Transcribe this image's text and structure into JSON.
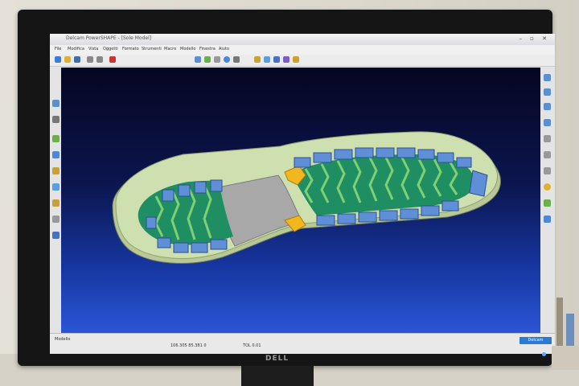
{
  "photo": {
    "subject": "monitor showing CAD shoe sole design",
    "monitor_brand": "DELL"
  },
  "window": {
    "title": "Delcam PowerSHAPE - [Sole Model]",
    "controls": "– ▫ ✕"
  },
  "menu": [
    "File",
    "Modifica",
    "Vista",
    "Oggetti",
    "Formato",
    "Strumenti",
    "Macro",
    "Modello",
    "Finestra",
    "Aiuto"
  ],
  "status": {
    "left_label": "Modello",
    "coords": "106.305   85.381   0",
    "right_text": "TOL  0.01",
    "app_badge": "Delcam"
  },
  "colors": {
    "tread_green": "#1f8f63",
    "lug_blue": "#5f8fd6",
    "sole_edge": "#c9d7a4",
    "insert_yellow": "#f2b61e",
    "shank_gray": "#a8a8a8"
  }
}
